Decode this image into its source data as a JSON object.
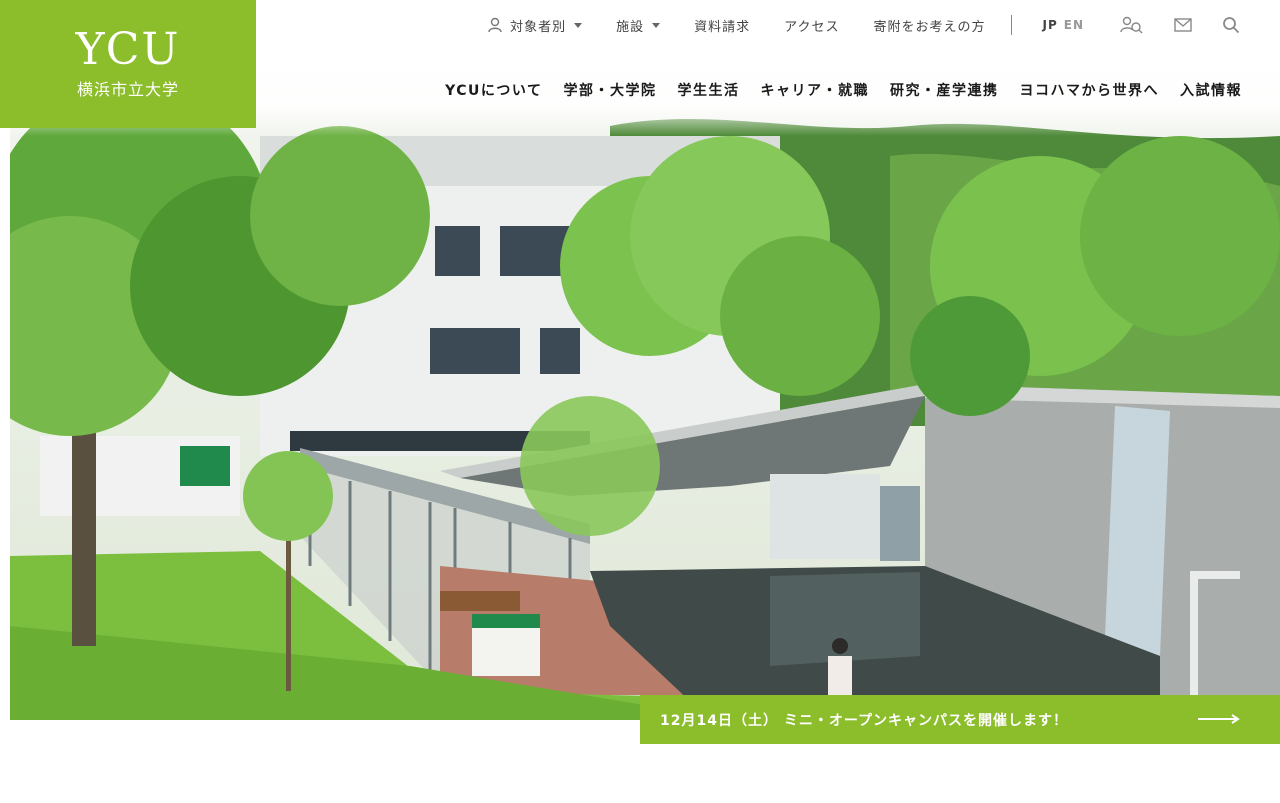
{
  "logo": {
    "mark": "YCU",
    "name": "横浜市立大学"
  },
  "utility_nav": {
    "audience": "対象者別",
    "facilities": "施設",
    "materials": "資料請求",
    "access": "アクセス",
    "donation": "寄附をお考えの方",
    "lang_jp": "JP",
    "lang_en": "EN"
  },
  "main_nav": [
    "YCUについて",
    "学部・大学院",
    "学生生活",
    "キャリア・就職",
    "研究・産学連携",
    "ヨコハマから世界へ",
    "入試情報"
  ],
  "banner": {
    "text": "12月14日（土） ミニ・オープンキャンパスを開催します！"
  },
  "colors": {
    "brand_green": "#8cbd2b"
  },
  "icons": [
    "user-icon",
    "people-search-icon",
    "mail-icon",
    "search-icon",
    "arrow-right-icon"
  ]
}
